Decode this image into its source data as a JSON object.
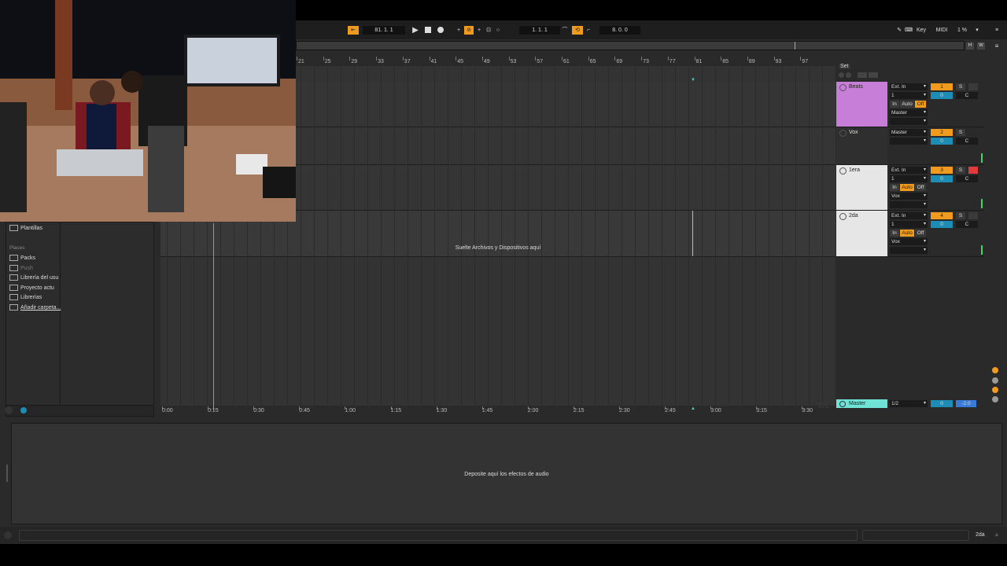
{
  "transport": {
    "tempo": "81. 1. 1",
    "position": "1. 1. 1",
    "loop_length": "8. 0. 0",
    "key_label": "Key",
    "midi_label": "MIDI",
    "cpu": "1 %",
    "overview_h": "H",
    "overview_w": "W"
  },
  "ruler": {
    "bars": [
      "21",
      "25",
      "29",
      "33",
      "37",
      "41",
      "45",
      "49",
      "53",
      "57",
      "61",
      "65",
      "69",
      "73",
      "77",
      "81",
      "85",
      "89",
      "93",
      "97"
    ]
  },
  "timeline": {
    "marks": [
      "0:00",
      "0:15",
      "0:30",
      "0:45",
      "1:00",
      "1:15",
      "1:30",
      "1:45",
      "2:00",
      "2:15",
      "2:30",
      "2:45",
      "3:00",
      "3:15",
      "3:30"
    ]
  },
  "set_label": "Set",
  "tracks": [
    {
      "name": "Beats",
      "color": "#c77ed8",
      "input": "Ext. In",
      "channel": "1",
      "monitor_in": "In",
      "monitor_auto": "Auto",
      "monitor_off": "Off",
      "output": "Master",
      "number": "1",
      "solo": "S",
      "volume": "0",
      "pan": "C"
    },
    {
      "name": "Vox",
      "color": "#2f2f2f",
      "input": "",
      "channel": "",
      "monitor_in": "",
      "monitor_auto": "",
      "monitor_off": "",
      "output": "Master",
      "number": "2",
      "solo": "S",
      "volume": "0",
      "pan": "C"
    },
    {
      "name": "1era",
      "color": "#e6e6e6",
      "input": "Ext. In",
      "channel": "1",
      "monitor_in": "In",
      "monitor_auto": "Auto",
      "monitor_off": "Off",
      "output": "Vox",
      "number": "3",
      "solo": "S",
      "volume": "0",
      "pan": "C"
    },
    {
      "name": "2da",
      "color": "#e6e6e6",
      "input": "Ext. In",
      "channel": "1",
      "monitor_in": "In",
      "monitor_auto": "Auto",
      "monitor_off": "Off",
      "output": "Vox",
      "number": "4",
      "solo": "S",
      "volume": "0",
      "pan": "C"
    }
  ],
  "master": {
    "name": "Master",
    "output": "1/2",
    "volume": "0",
    "pan": "-2.0",
    "counter": "2/1"
  },
  "arrangement_drop": "Suelte Archivos y Dispositivos aquí",
  "device_drop": "Deposite aquí los efectos de audio",
  "browser": {
    "templates": "Plantillas",
    "places_header": "Places",
    "places": [
      "Packs",
      "Push",
      "Librería del usu",
      "Proyecto actu",
      "Librerías",
      "Añadir carpeta..."
    ]
  },
  "status": {
    "selected_track": "2da"
  }
}
